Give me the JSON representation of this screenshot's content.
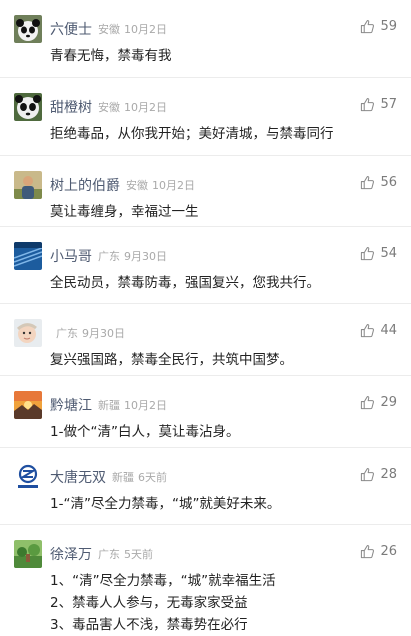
{
  "icons": {
    "like": "thumbs-up-icon"
  },
  "colors": {
    "nickname": "#4f5b72",
    "meta": "#a9a9a9",
    "text": "#222222",
    "like": "#7b7b7b"
  },
  "comments": [
    {
      "nickname": "六便士",
      "location": "安徽",
      "date": "10月2日",
      "likes": "59",
      "text": "青春无悔，禁毒有我",
      "avatar": "panda-1"
    },
    {
      "nickname": "甜橙树",
      "location": "安徽",
      "date": "10月2日",
      "likes": "57",
      "text": "拒绝毒品，从你我开始；美好清城，与禁毒同行",
      "avatar": "panda-2"
    },
    {
      "nickname": "树上的伯爵",
      "location": "安徽",
      "date": "10月2日",
      "likes": "56",
      "text": "莫让毒缠身，幸福过一生",
      "avatar": "portrait"
    },
    {
      "nickname": "小马哥",
      "location": "广东",
      "date": "9月30日",
      "likes": "54",
      "text": "全民动员，禁毒防毒，强国复兴，您我共行。",
      "avatar": "blue-lines"
    },
    {
      "nickname": "",
      "location": "广东",
      "date": "9月30日",
      "likes": "44",
      "text": "复兴强国路，禁毒全民行，共筑中国梦。",
      "avatar": "baby"
    },
    {
      "nickname": "黔塘江",
      "location": "新疆",
      "date": "10月2日",
      "likes": "29",
      "text": "1-做个“清”白人，莫让毒沾身。",
      "avatar": "sunset"
    },
    {
      "nickname": "大唐无双",
      "location": "新疆",
      "date": "6天前",
      "likes": "28",
      "text": "1-“清”尽全力禁毒，“城”就美好未来。",
      "avatar": "logo"
    },
    {
      "nickname": "徐泽万",
      "location": "广东",
      "date": "5天前",
      "likes": "26",
      "text": "1、“清”尽全力禁毒，“城”就幸福生活\n2、禁毒人人参与，无毒家家受益\n3、毒品害人不浅，禁毒势在必行",
      "avatar": "garden"
    }
  ]
}
